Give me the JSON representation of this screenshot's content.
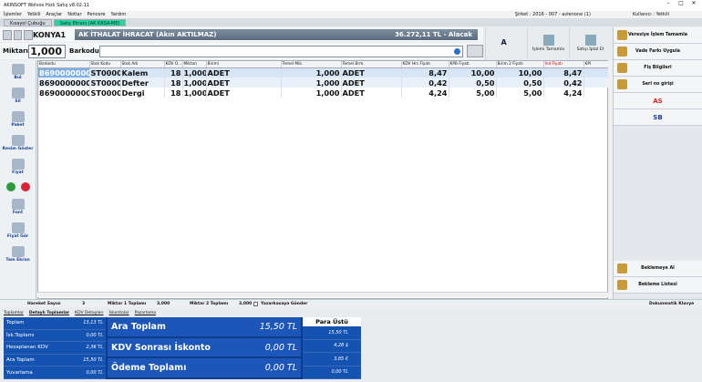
{
  "window": {
    "title": "AKINSOFT Wolvox Hızlı Satış v8.02.11"
  },
  "menu": {
    "items": [
      "İşlemler",
      "Yetkili",
      "Araçlar",
      "Notlar",
      "Pencere",
      "Yardım"
    ],
    "company": "Şirket : 2016 - 007 - avlenone (1)",
    "user": "Kullanıcı : Yetkili"
  },
  "tabs": [
    "Kısayol Çubuğu",
    "Satış Ekranı (AK KASA-ME)"
  ],
  "customer": {
    "store": "KONYA1",
    "name": "AK İTHALAT İHRACAT (Akın AKTILMAZ)",
    "balance": "36.272,11 TL - Alacak"
  },
  "quantity": {
    "label": "Miktarı",
    "value": "1,000",
    "barcode_label": "Barkodu"
  },
  "top_buttons": [
    {
      "label": "A"
    },
    {
      "label": "İşlemi Tamamla"
    },
    {
      "label": "Satışı İptal Et"
    }
  ],
  "right_buttons": [
    "Veresiye İşlem Tamamla",
    "Vade Farkı Uygula",
    "Fiş Bilgileri",
    "Seri no girişi",
    "AS",
    "SB",
    "Beklemeye Al",
    "Bekleme Listesi"
  ],
  "left_buttons": [
    "Bul",
    "Sil",
    "Paket",
    "Resim Göster",
    "Fiyat",
    "Font",
    "Fiyat Gör",
    "Tam Ekran"
  ],
  "grid": {
    "columns": [
      "Barkodu",
      "Stok Kodu",
      "Stok Adı",
      "KDV O...",
      "Miktarı",
      "Birimi",
      "Temel Mik.",
      "Temel Brm.",
      "KDV Hrc.Fiyatı",
      "KPB Fiyatı",
      "Birim 2 Fiyatı",
      "İnd.Fiyatı",
      "KPI"
    ],
    "rows": [
      [
        "8690000000",
        "ST0000",
        "Kalem",
        "18",
        "1,000",
        "ADET",
        "1,000",
        "ADET",
        "8,47",
        "10,00",
        "10,00",
        "8,47",
        ""
      ],
      [
        "8690000000",
        "ST0000",
        "Defter",
        "18",
        "1,000",
        "ADET",
        "1,000",
        "ADET",
        "0,42",
        "0,50",
        "0,50",
        "0,42",
        ""
      ],
      [
        "8690000000",
        "ST0000",
        "Dergi",
        "18",
        "1,000",
        "ADET",
        "1,000",
        "ADET",
        "4,24",
        "5,00",
        "5,00",
        "4,24",
        ""
      ]
    ]
  },
  "status": {
    "hareket_label": "Hareket Sayısı",
    "hareket": "3",
    "m1_label": "Miktar 1 Toplamı",
    "m1": "3,000",
    "m2_label": "Miktar 2 Toplamı",
    "m2": "3,000",
    "print_label": "Yazarkasaya Gönder",
    "doc_label": "Dokunmatik Klavye"
  },
  "subtabs": [
    "Toplamlar",
    "Detaylı Toplamlar",
    "KDV Detayları",
    "İskontolar",
    "Pazarlama"
  ],
  "totals": {
    "left": [
      {
        "k": "Toplam",
        "v": "13,13 TL"
      },
      {
        "k": "İsk.Toplamı",
        "v": "0,00 TL"
      },
      {
        "k": "Hesaplanan KDV",
        "v": "2,36 TL"
      },
      {
        "k": "Ara Toplam",
        "v": "15,50 TL"
      },
      {
        "k": "Yuvarlama",
        "v": "0,00 TL"
      }
    ],
    "main": [
      {
        "k": "Ara Toplam",
        "v": "15,50 TL"
      },
      {
        "k": "KDV Sonrası İskonto",
        "v": "0,00 TL"
      },
      {
        "k": "Ödeme Toplamı",
        "v": "0,00 TL"
      }
    ],
    "change_title": "Para Üstü",
    "change": [
      "15,50 TL",
      "4,28 $",
      "3,85 €",
      "0,00 TL"
    ]
  }
}
